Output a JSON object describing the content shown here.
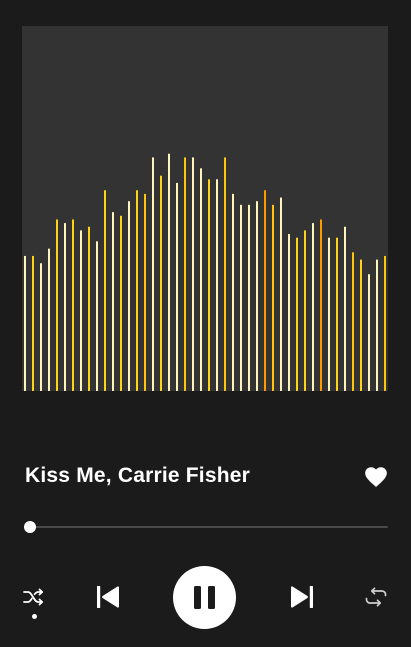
{
  "player": {
    "track_title": "Kiss Me, Carrie Fisher",
    "liked": true,
    "progress_fraction": 0.0,
    "shuffle_enabled": true
  },
  "visualizer": {
    "colors": [
      "#fff4bd",
      "#ffd21d",
      "#ffc40d",
      "#ff9a00"
    ],
    "levels": [
      0.37,
      0.37,
      0.35,
      0.39,
      0.47,
      0.46,
      0.47,
      0.44,
      0.45,
      0.41,
      0.55,
      0.49,
      0.48,
      0.52,
      0.55,
      0.54,
      0.64,
      0.59,
      0.65,
      0.57,
      0.64,
      0.64,
      0.61,
      0.58,
      0.58,
      0.64,
      0.54,
      0.51,
      0.51,
      0.52,
      0.55,
      0.51,
      0.53,
      0.43,
      0.42,
      0.44,
      0.46,
      0.47,
      0.42,
      0.42,
      0.45,
      0.38,
      0.36,
      0.32,
      0.36,
      0.37
    ],
    "color_index": [
      0,
      1,
      0,
      0,
      1,
      0,
      1,
      0,
      1,
      0,
      1,
      0,
      1,
      0,
      1,
      2,
      0,
      1,
      0,
      0,
      2,
      0,
      0,
      1,
      0,
      2,
      0,
      0,
      0,
      0,
      3,
      2,
      0,
      0,
      1,
      1,
      0,
      3,
      0,
      1,
      0,
      2,
      1,
      0,
      0,
      2
    ]
  },
  "icons": {
    "like": "heart-icon",
    "shuffle": "shuffle-icon",
    "previous": "skip-previous-icon",
    "play_pause": "pause-icon",
    "next": "skip-next-icon",
    "repeat": "repeat-icon"
  }
}
